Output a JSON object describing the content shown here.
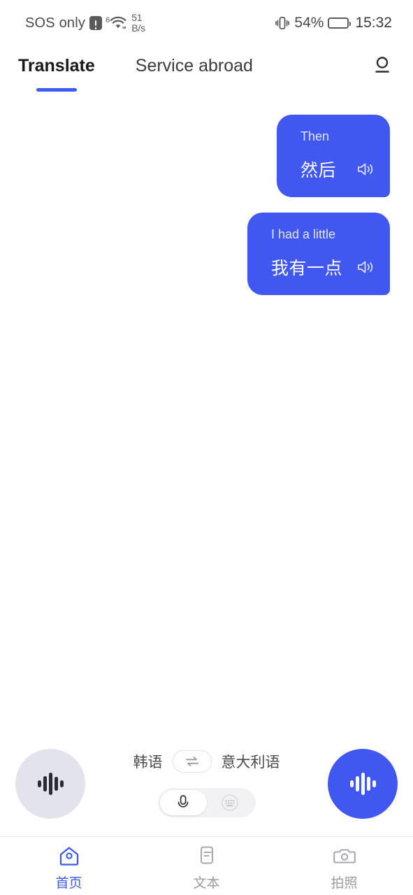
{
  "statusbar": {
    "carrier": "SOS only",
    "wifi_generation": "6",
    "network_speed": "51",
    "network_speed_unit": "B/s",
    "battery_percent": "54%",
    "time": "15:32",
    "icons": {
      "alert": "alert-icon",
      "wifi": "wifi-icon",
      "vibrate": "vibrate-icon",
      "battery": "battery-icon"
    }
  },
  "header": {
    "tabs": [
      {
        "label": "Translate",
        "active": true
      },
      {
        "label": "Service abroad",
        "active": false
      }
    ],
    "profile_icon": "person-icon"
  },
  "chat": {
    "messages": [
      {
        "source_text": "Then",
        "translated_text": "然后",
        "speaker_icon": "speaker-icon"
      },
      {
        "source_text": "I had a little",
        "translated_text": "我有一点",
        "speaker_icon": "speaker-icon"
      }
    ]
  },
  "controls": {
    "left_mic_button": "waveform-icon",
    "right_mic_button": "waveform-icon",
    "source_language": "韩语",
    "target_language": "意大利语",
    "swap_icon": "swap-arrows-icon",
    "input_modes": [
      {
        "icon": "microphone-icon",
        "selected": true
      },
      {
        "icon": "keyboard-icon",
        "selected": false
      }
    ]
  },
  "bottom_nav": {
    "items": [
      {
        "label": "首页",
        "icon": "home-icon",
        "active": true
      },
      {
        "label": "文本",
        "icon": "document-icon",
        "active": false
      },
      {
        "label": "拍照",
        "icon": "camera-icon",
        "active": false
      }
    ]
  },
  "colors": {
    "accent": "#4058f0",
    "accent_tab": "#3c5bee",
    "bubble_bg": "#4058f0",
    "left_button_bg": "#e3e3ee",
    "inactive_text": "#9a9aa5"
  }
}
